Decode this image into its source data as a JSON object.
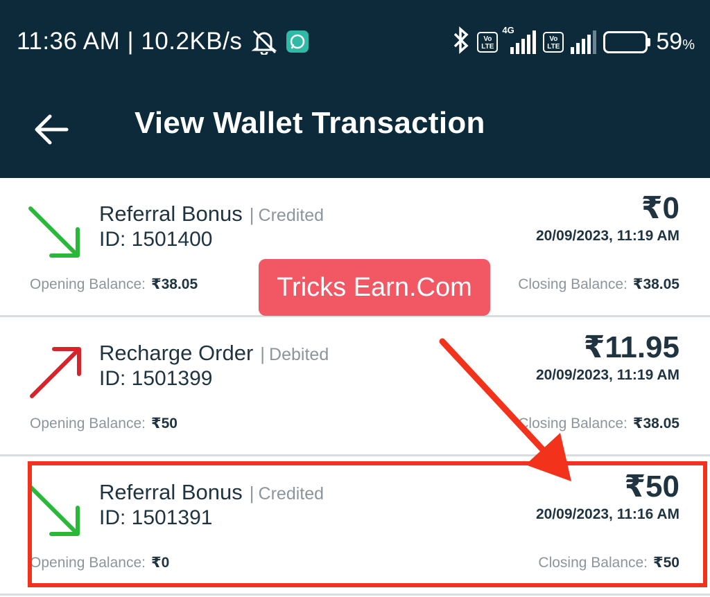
{
  "status_bar": {
    "time_speed": "11:36 AM | 10.2KB/s",
    "volte_label": "Vo LTE",
    "network_label": "4G",
    "battery_percent": "59",
    "battery_unit": "%",
    "battery_level": 0.59,
    "icons": [
      "bell-off-icon",
      "whatsapp-icon",
      "bluetooth-icon",
      "volte-icon",
      "signal-icon",
      "battery-icon"
    ]
  },
  "app_bar": {
    "title": "View Wallet Transaction",
    "back_icon": "arrow-left-icon"
  },
  "transactions": [
    {
      "title": "Referral Bonus",
      "separator": "|",
      "type": "Credited",
      "id": "ID: 1501400",
      "amount": "₹0",
      "datetime": "20/09/2023, 11:19 AM",
      "opening_label": "Opening Balance:",
      "opening_value": "₹38.05",
      "closing_label": "Closing Balance:",
      "closing_value": "₹38.05",
      "arrow_color": "#2ab83a"
    },
    {
      "title": "Recharge Order",
      "separator": "|",
      "type": "Debited",
      "id": "ID: 1501399",
      "amount": "₹11.95",
      "datetime": "20/09/2023, 11:19 AM",
      "opening_label": "Opening Balance:",
      "opening_value": "₹50",
      "closing_label": "Closing Balance:",
      "closing_value": "₹38.05",
      "arrow_color": "#d6242b"
    },
    {
      "title": "Referral Bonus",
      "separator": "|",
      "type": "Credited",
      "id": "ID: 1501391",
      "amount": "₹50",
      "datetime": "20/09/2023, 11:16 AM",
      "opening_label": "Opening Balance:",
      "opening_value": "₹0",
      "closing_label": "Closing Balance:",
      "closing_value": "₹50",
      "arrow_color": "#2ab83a"
    }
  ],
  "overlay": {
    "watermark": "Tricks Earn.Com",
    "highlight_color": "#f2321b"
  },
  "colors": {
    "header_bg": "#0c2a3a",
    "credit_green": "#2ab83a",
    "debit_red": "#d6242b",
    "muted_text": "#8b959b"
  }
}
